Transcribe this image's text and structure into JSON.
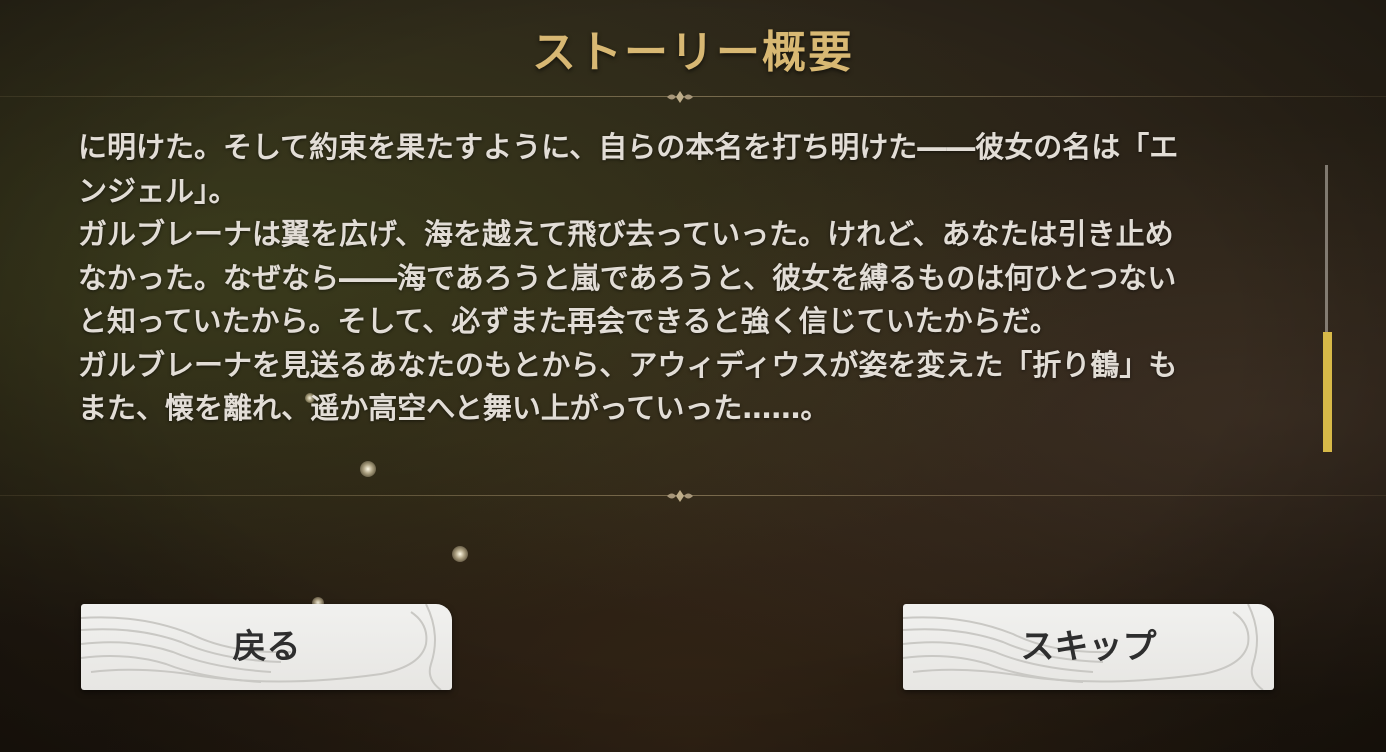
{
  "title": "ストーリー概要",
  "summary": {
    "lines": [
      "に明けた。そして約束を果たすように、自らの本名を打ち明けた――彼女の名は「エ",
      "ンジェル」。",
      "ガルブレーナは翼を広げ、海を越えて飛び去っていった。けれど、あなたは引き止め",
      "なかった。なぜなら――海であろうと嵐であろうと、彼女を縛るものは何ひとつない",
      "と知っていたから。そして、必ずまた再会できると強く信じていたからだ。",
      "ガルブレーナを見送るあなたのもとから、アウィディウスが姿を変えた「折り鶴」も",
      "また、懐を離れ、遥か高空へと舞い上がっていった……。"
    ]
  },
  "scroll": {
    "position": 0.58
  },
  "buttons": {
    "back_label": "戻る",
    "skip_label": "スキップ"
  },
  "colors": {
    "title": "#d8b873",
    "text": "#e2ddd6",
    "scroll_thumb": "#d7b948",
    "button_bg": "#eeeeec"
  },
  "icons": {
    "divider": "ornament-divider-icon",
    "button_decoration": "swirl-pattern-icon"
  }
}
